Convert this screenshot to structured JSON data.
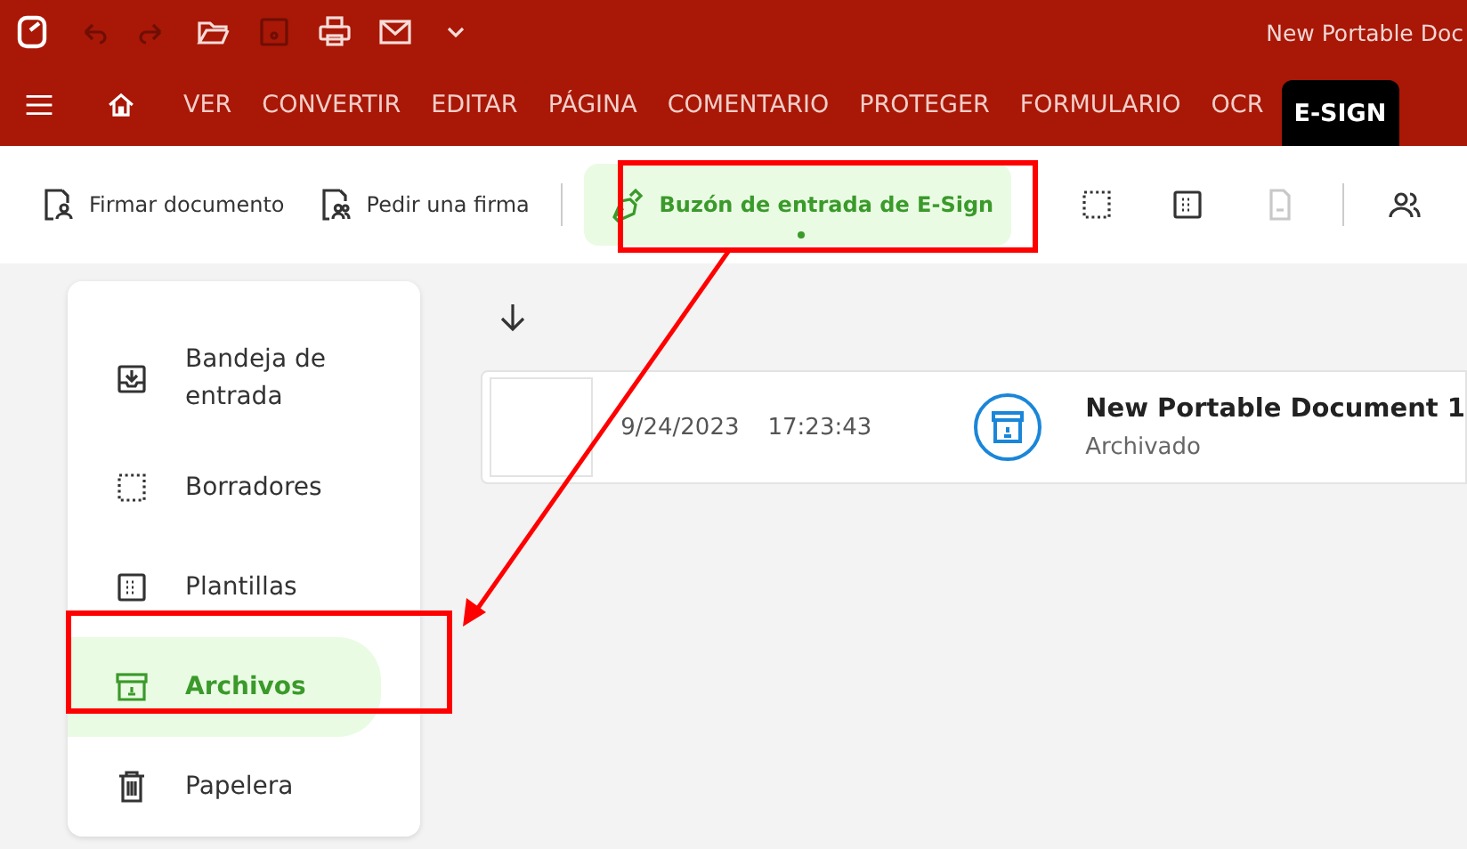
{
  "window": {
    "title": "New Portable Doc"
  },
  "tabs": [
    {
      "label": "VER",
      "selected": false
    },
    {
      "label": "CONVERTIR",
      "selected": false
    },
    {
      "label": "EDITAR",
      "selected": false
    },
    {
      "label": "PÁGINA",
      "selected": false
    },
    {
      "label": "COMENTARIO",
      "selected": false
    },
    {
      "label": "PROTEGER",
      "selected": false
    },
    {
      "label": "FORMULARIO",
      "selected": false
    },
    {
      "label": "OCR",
      "selected": false
    },
    {
      "label": "E-SIGN",
      "selected": true
    }
  ],
  "toolbar": {
    "buttons": [
      {
        "label": "Firmar documento",
        "selected": false
      },
      {
        "label": "Pedir una firma",
        "selected": false
      },
      {
        "label": "Buzón de entrada de E-Sign",
        "selected": true
      }
    ],
    "icon_tools": [
      {
        "disabled": false
      },
      {
        "disabled": false
      },
      {
        "disabled": true
      },
      {
        "disabled": false
      }
    ]
  },
  "sidebar": {
    "items": [
      {
        "label": "Bandeja de entrada",
        "selected": false
      },
      {
        "label": "Borradores",
        "selected": false
      },
      {
        "label": "Plantillas",
        "selected": false
      },
      {
        "label": "Archivos",
        "selected": true
      },
      {
        "label": "Papelera",
        "selected": false
      }
    ]
  },
  "documents": [
    {
      "date": "9/24/2023",
      "time": "17:23:43",
      "name": "New Portable Document 1",
      "status": "Archivado"
    }
  ]
}
